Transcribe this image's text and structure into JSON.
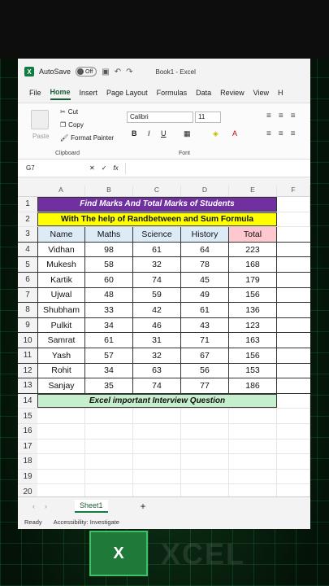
{
  "window": {
    "autosave": "AutoSave",
    "toggle": "Off",
    "book": "Book1 - Excel"
  },
  "menu": [
    "File",
    "Home",
    "Insert",
    "Page Layout",
    "Formulas",
    "Data",
    "Review",
    "View",
    "H"
  ],
  "ribbon": {
    "paste": "Paste",
    "cut": "Cut",
    "copy": "Copy",
    "format_painter": "Format Painter",
    "clipboard": "Clipboard",
    "font_name": "Calibri",
    "font_size": "11",
    "font_group": "Font",
    "bold": "B",
    "italic": "I",
    "underline": "U"
  },
  "formula_bar": {
    "namebox": "G7",
    "fx": "fx"
  },
  "columns": [
    "A",
    "B",
    "C",
    "D",
    "E",
    "F"
  ],
  "title1": "Find Marks And Total Marks of Students",
  "title2": "With The help of Randbetween and Sum Formula",
  "headers": [
    "Name",
    "Maths",
    "Science",
    "History",
    "Total"
  ],
  "students": [
    [
      "Vidhan",
      "98",
      "61",
      "64",
      "223"
    ],
    [
      "Mukesh",
      "58",
      "32",
      "78",
      "168"
    ],
    [
      "Kartik",
      "60",
      "74",
      "45",
      "179"
    ],
    [
      "Ujwal",
      "48",
      "59",
      "49",
      "156"
    ],
    [
      "Shubham",
      "33",
      "42",
      "61",
      "136"
    ],
    [
      "Pulkit",
      "34",
      "46",
      "43",
      "123"
    ],
    [
      "Samrat",
      "61",
      "31",
      "71",
      "163"
    ],
    [
      "Yash",
      "57",
      "32",
      "67",
      "156"
    ],
    [
      "Rohit",
      "34",
      "63",
      "56",
      "153"
    ],
    [
      "Sanjay",
      "35",
      "74",
      "77",
      "186"
    ]
  ],
  "footer": "Excel important Interview Question",
  "row_numbers": [
    "1",
    "2",
    "3",
    "4",
    "5",
    "6",
    "7",
    "8",
    "9",
    "10",
    "11",
    "12",
    "13",
    "14",
    "15",
    "16",
    "17",
    "18",
    "19",
    "20"
  ],
  "sheet_tab": "Sheet1",
  "status": {
    "ready": "Ready",
    "accessibility": "Accessibility: Investigate"
  },
  "colors": {
    "title_bg": "#7030a0",
    "subtitle_bg": "#ffff00",
    "header_bg": "#ddebf7",
    "footer_bg": "#c6efce",
    "total_bg": "#ffc7ce"
  },
  "watermark": {
    "logo": "X",
    "text": "XCEL"
  }
}
